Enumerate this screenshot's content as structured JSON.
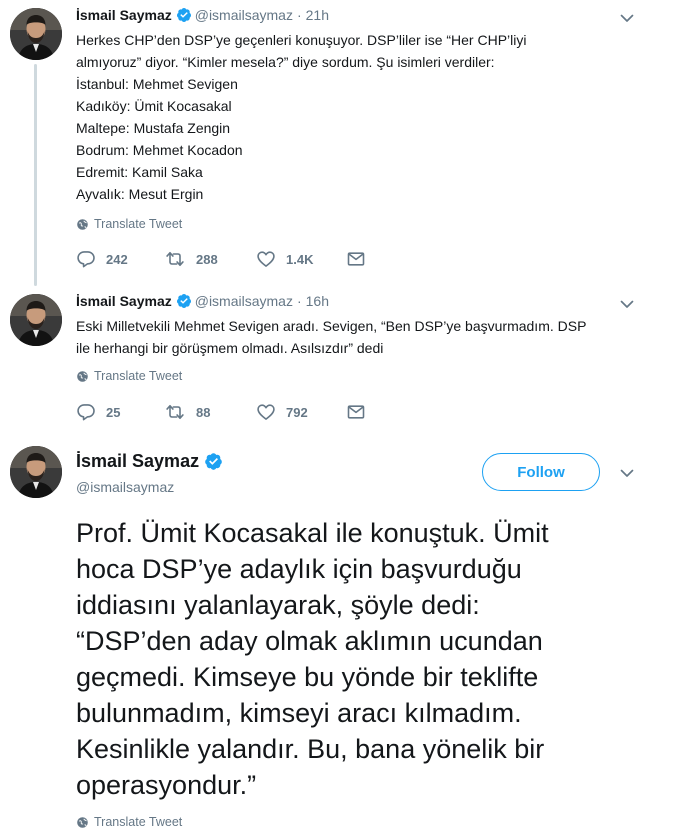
{
  "colors": {
    "accent": "#1da1f2",
    "muted": "#657786",
    "text": "#14171a",
    "thread": "#cfd9de"
  },
  "tweets": [
    {
      "name": "İsmail Saymaz",
      "handle": "@ismailsaymaz",
      "time": "21h",
      "text": "Herkes CHP’den DSP’ye geçenleri konuşuyor. DSP’liler ise “Her CHP’liyi\nalmıyoruz” diyor. “Kimler mesela?” diye sordum. Şu isimleri verdiler:\nİstanbul: Mehmet Sevigen\nKadıköy: Ümit Kocasakal\nMaltepe: Mustafa Zengin\nBodrum: Mehmet Kocadon\nEdremit: Kamil Saka\nAyvalık: Mesut Ergin",
      "translate": "Translate Tweet",
      "replies": "242",
      "retweets": "288",
      "likes": "1.4K"
    },
    {
      "name": "İsmail Saymaz",
      "handle": "@ismailsaymaz",
      "time": "16h",
      "text": "Eski Milletvekili Mehmet Sevigen aradı. Sevigen, “Ben DSP’ye başvurmadım. DSP\nile herhangi bir görüşmem olmadı. Asılsızdır” dedi",
      "translate": "Translate Tweet",
      "replies": "25",
      "retweets": "88",
      "likes": "792"
    }
  ],
  "main_tweet": {
    "name": "İsmail Saymaz",
    "handle": "@ismailsaymaz",
    "follow_label": "Follow",
    "text": "Prof. Ümit Kocasakal ile konuştuk. Ümit\nhoca DSP’ye adaylık için başvurduğu\niddiasını yalanlayarak, şöyle dedi:\n“DSP’den aday olmak aklımın ucundan\ngeçmedi. Kimseye bu yönde bir teklifte\nbulunmadım, kimseyi aracı kılmadım.\nKesinlikle yalandır. Bu, bana yönelik bir\noperasyondur.”",
    "translate": "Translate Tweet"
  },
  "icons": [
    "verified-badge-icon",
    "chevron-down-icon",
    "globe-icon",
    "reply-icon",
    "retweet-icon",
    "like-icon",
    "message-icon"
  ]
}
